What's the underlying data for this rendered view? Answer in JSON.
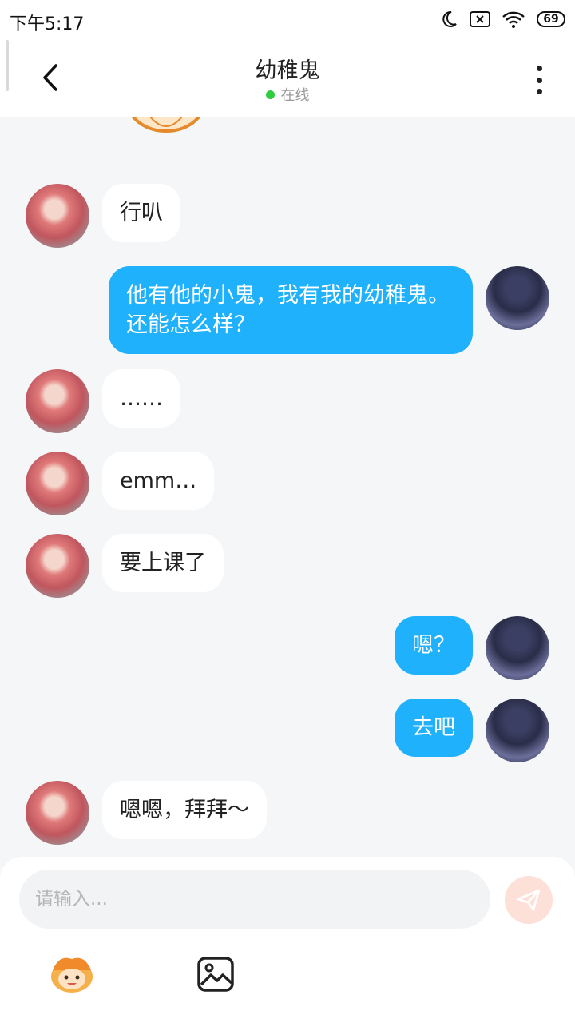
{
  "status_bar": {
    "time": "下午5:17",
    "battery": "69",
    "icons": [
      "moon-icon",
      "notification-x-icon",
      "wifi-icon",
      "battery-icon"
    ]
  },
  "header": {
    "title": "幼稚鬼",
    "status": "在线",
    "icons": [
      "back-arrow-icon",
      "more-vertical-icon"
    ]
  },
  "messages": [
    {
      "side": "left",
      "text": "行叭"
    },
    {
      "side": "right",
      "text": "他有他的小鬼，我有我的幼稚鬼。还能怎么样？"
    },
    {
      "side": "left",
      "text": "……"
    },
    {
      "side": "left",
      "text": "emm…"
    },
    {
      "side": "left",
      "text": "要上课了"
    },
    {
      "side": "right",
      "text": "嗯？"
    },
    {
      "side": "right",
      "text": "去吧"
    },
    {
      "side": "left",
      "text": "嗯嗯，拜拜～"
    }
  ],
  "input": {
    "placeholder": "请输入...",
    "value": ""
  },
  "toolbar": {
    "icons": [
      "send-icon",
      "emoji-icon",
      "image-icon"
    ]
  },
  "colors": {
    "sent_bubble": "#1fb1fb",
    "received_bubble": "#ffffff",
    "background": "#f5f6f8",
    "online_dot": "#2ecc40",
    "send_button": "#fde0d8"
  }
}
